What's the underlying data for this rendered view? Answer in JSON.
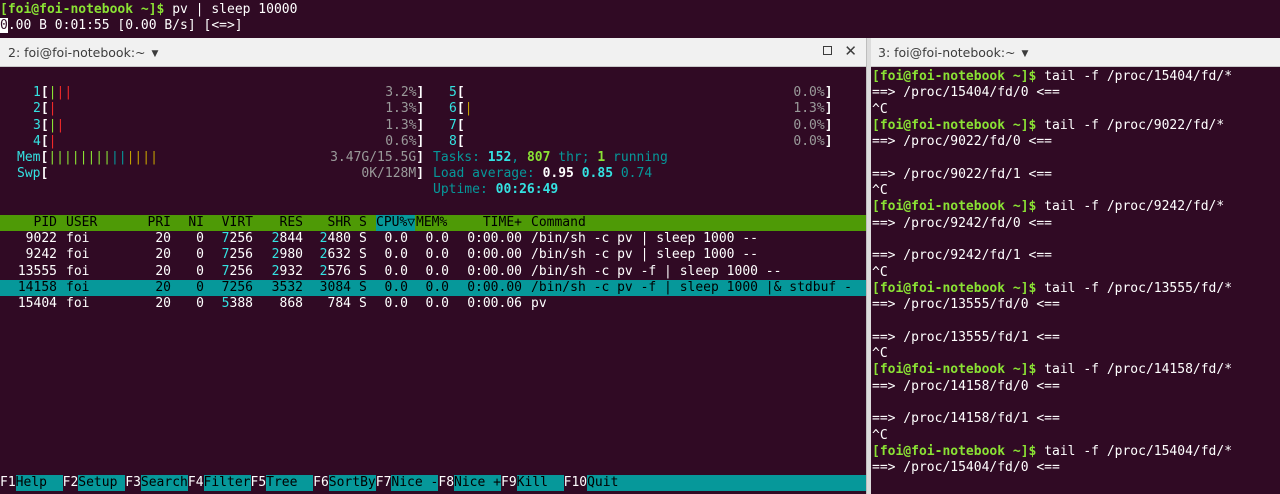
{
  "top_terminal": {
    "prompt": "[foi@foi-notebook ~]$",
    "command": " pv | sleep 10000",
    "status_first_char": "0",
    "status_rest": ".00 B 0:01:55 [0.00 B/s] [<=>]"
  },
  "left_tab": {
    "title": "2: foi@foi-notebook:~",
    "arrow": "▼"
  },
  "right_tab": {
    "title": "3: foi@foi-notebook:~",
    "arrow": "▼"
  },
  "htop": {
    "cpus_left": [
      {
        "num": "1",
        "bar": "|||",
        "pct": "3.2%"
      },
      {
        "num": "2",
        "bar": "|",
        "pct": "1.3%"
      },
      {
        "num": "3",
        "bar": "||",
        "pct": "1.3%"
      },
      {
        "num": "4",
        "bar": "|",
        "pct": "0.6%"
      }
    ],
    "cpus_right": [
      {
        "num": "5",
        "bar": "",
        "pct": "0.0%"
      },
      {
        "num": "6",
        "bar": "|",
        "pct": "1.3%"
      },
      {
        "num": "7",
        "bar": "",
        "pct": "0.0%"
      },
      {
        "num": "8",
        "bar": "",
        "pct": "0.0%"
      }
    ],
    "mem": {
      "label": "Mem",
      "bar": "||||||||||||||",
      "value": "3.47G/15.5G"
    },
    "swp": {
      "label": "Swp",
      "value": "0K/128M"
    },
    "tasks": {
      "label": "Tasks: ",
      "count": "152",
      "sep": ", ",
      "threads": "807",
      "thr": " thr; ",
      "running": "1",
      "running_label": " running"
    },
    "load": {
      "label": "Load average: ",
      "l1": "0.95",
      "l5": "0.85",
      "l15": "0.74"
    },
    "uptime": {
      "label": "Uptime: ",
      "value": "00:26:49"
    },
    "columns": [
      "PID",
      "USER",
      "PRI",
      "NI",
      "VIRT",
      "RES",
      "SHR",
      "S",
      "CPU%▽",
      "MEM%",
      "TIME+",
      "Command"
    ],
    "processes": [
      {
        "pid": "9022",
        "user": "foi",
        "pri": "20",
        "ni": "0",
        "virt": "7256",
        "res": "2844",
        "shr": "2480",
        "s": "S",
        "cpu": "0.0",
        "mem": "0.0",
        "time": "0:00.00",
        "cmd": "/bin/sh -c pv | sleep 1000 --"
      },
      {
        "pid": "9242",
        "user": "foi",
        "pri": "20",
        "ni": "0",
        "virt": "7256",
        "res": "2980",
        "shr": "2632",
        "s": "S",
        "cpu": "0.0",
        "mem": "0.0",
        "time": "0:00.00",
        "cmd": "/bin/sh -c pv | sleep 1000 --"
      },
      {
        "pid": "13555",
        "user": "foi",
        "pri": "20",
        "ni": "0",
        "virt": "7256",
        "res": "2932",
        "shr": "2576",
        "s": "S",
        "cpu": "0.0",
        "mem": "0.0",
        "time": "0:00.00",
        "cmd": "/bin/sh -c pv -f | sleep 1000 --"
      },
      {
        "pid": "14158",
        "user": "foi",
        "pri": "20",
        "ni": "0",
        "virt": "7256",
        "res": "3532",
        "shr": "3084",
        "s": "S",
        "cpu": "0.0",
        "mem": "0.0",
        "time": "0:00.00",
        "cmd": "/bin/sh -c pv -f | sleep 1000 |& stdbuf -"
      },
      {
        "pid": "15404",
        "user": "foi",
        "pri": "20",
        "ni": "0",
        "virt": "5388",
        "res": "868",
        "shr": "784",
        "s": "S",
        "cpu": "0.0",
        "mem": "0.0",
        "time": "0:00.06",
        "cmd": "pv"
      }
    ],
    "selected_index": 3,
    "fkeys": [
      {
        "key": "F1",
        "label": "Help  "
      },
      {
        "key": "F2",
        "label": "Setup "
      },
      {
        "key": "F3",
        "label": "Search"
      },
      {
        "key": "F4",
        "label": "Filter"
      },
      {
        "key": "F5",
        "label": "Tree  "
      },
      {
        "key": "F6",
        "label": "SortBy"
      },
      {
        "key": "F7",
        "label": "Nice -"
      },
      {
        "key": "F8",
        "label": "Nice +"
      },
      {
        "key": "F9",
        "label": "Kill  "
      },
      {
        "key": "F10",
        "label": "Quit                                      "
      }
    ]
  },
  "right_terminal": {
    "lines": [
      {
        "prompt": "[foi@foi-notebook ~]$",
        "text": " tail -f /proc/15404/fd/*"
      },
      {
        "text": "==> /proc/15404/fd/0 <=="
      },
      {
        "text": "^C"
      },
      {
        "prompt": "[foi@foi-notebook ~]$",
        "text": " tail -f /proc/9022/fd/*"
      },
      {
        "text": "==> /proc/9022/fd/0 <=="
      },
      {
        "text": ""
      },
      {
        "text": "==> /proc/9022/fd/1 <=="
      },
      {
        "text": "^C"
      },
      {
        "prompt": "[foi@foi-notebook ~]$",
        "text": " tail -f /proc/9242/fd/*"
      },
      {
        "text": "==> /proc/9242/fd/0 <=="
      },
      {
        "text": ""
      },
      {
        "text": "==> /proc/9242/fd/1 <=="
      },
      {
        "text": "^C"
      },
      {
        "prompt": "[foi@foi-notebook ~]$",
        "text": " tail -f /proc/13555/fd/*"
      },
      {
        "text": "==> /proc/13555/fd/0 <=="
      },
      {
        "text": ""
      },
      {
        "text": "==> /proc/13555/fd/1 <=="
      },
      {
        "text": "^C"
      },
      {
        "prompt": "[foi@foi-notebook ~]$",
        "text": " tail -f /proc/14158/fd/*"
      },
      {
        "text": "==> /proc/14158/fd/0 <=="
      },
      {
        "text": ""
      },
      {
        "text": "==> /proc/14158/fd/1 <=="
      },
      {
        "text": "^C"
      },
      {
        "prompt": "[foi@foi-notebook ~]$",
        "text": " tail -f /proc/15404/fd/*"
      },
      {
        "text": "==> /proc/15404/fd/0 <=="
      }
    ]
  },
  "colors": {
    "background": "#300a24",
    "prompt": "#8ae234",
    "header": "#4e9a06",
    "selection": "#06989a"
  }
}
